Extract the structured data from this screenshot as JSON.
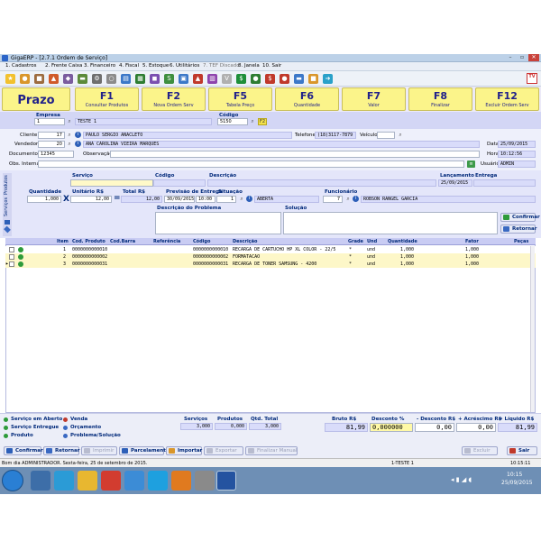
{
  "window": {
    "title": "GigaERP - [2.7.1 Ordem de Serviço]"
  },
  "menu": [
    "1. Cadastros",
    "2. Frente Caixa",
    "3. Financeiro",
    "4. Fiscal",
    "5. Estoque",
    "6. Utilitários",
    "7. TEF Discado",
    "8. Janela",
    "10. Sair"
  ],
  "toolbar": {
    "tv_label": "TV"
  },
  "fkeys": [
    {
      "key": "Prazo",
      "label": ""
    },
    {
      "key": "F1",
      "label": "Consultar Produtos"
    },
    {
      "key": "F2",
      "label": "Nova Ordem Serv"
    },
    {
      "key": "F5",
      "label": "Tabela Preço"
    },
    {
      "key": "F6",
      "label": "Quantidade"
    },
    {
      "key": "F7",
      "label": "Valor"
    },
    {
      "key": "F8",
      "label": "Finalizar"
    },
    {
      "key": "F12",
      "label": "Excluir Ordem Serv"
    }
  ],
  "empresa": {
    "label": "Empresa",
    "code": "1",
    "name": "TESTE 1"
  },
  "codigo": {
    "label": "Código",
    "value": "5150",
    "flag": "F2"
  },
  "cliente": {
    "label": "Cliente",
    "code": "17",
    "name": "PAULO SERGIO ANACLETO"
  },
  "telefone": {
    "label": "Telefone",
    "value": "(18)3117-7879"
  },
  "veiculo": {
    "label": "Veículo",
    "value": ""
  },
  "vendedor": {
    "label": "Vendedor",
    "code": "20",
    "name": "ANA CAROLINA VIEIRA MARQUES"
  },
  "data": {
    "label": "Data",
    "value": "25/09/2015"
  },
  "documento": {
    "label": "Documento",
    "value": "12345"
  },
  "observacao": {
    "label": "Observação",
    "value": ""
  },
  "hora": {
    "label": "Hora",
    "value": "10:12:56"
  },
  "obs_interna": {
    "label": "Obs. Interna",
    "value": ""
  },
  "usuario": {
    "label": "Usuário",
    "value": "ADMIN"
  },
  "side_tabs": [
    "Produtos",
    "Serviços"
  ],
  "servico_form": {
    "servico_label": "Serviço",
    "codigo_label": "Código",
    "descricao_label": "Descrição",
    "lancamento_label": "Lançamento",
    "lancamento_value": "25/09/2015",
    "entrega_label": "Entrega",
    "quantidade_label": "Quantidade",
    "quantidade_value": "1,000",
    "unitario_label": "Unitário R$",
    "unitario_value": "12,00",
    "total_label": "Total R$",
    "total_value": "12,00",
    "previsao_label": "Previsão de Entrega",
    "previsao_date": "30/09/2015",
    "previsao_time": "10:00",
    "situacao_label": "Situação",
    "situacao_code": "1",
    "situacao_value": "ABERTA",
    "funcionario_label": "Funcionário",
    "funcionario_code": "7",
    "funcionario_name": "ROBSON RANGEL GARCIA",
    "problema_label": "Descrição do Problema",
    "solucao_label": "Solução",
    "confirmar": "Confirmar",
    "retornar": "Retornar"
  },
  "grid": {
    "headers": [
      "Item",
      "Cod. Produto",
      "Cod.Barra",
      "Referência",
      "Código",
      "Descrição",
      "Grade",
      "Und",
      "Quantidade",
      "Fator",
      "Peças"
    ],
    "rows": [
      {
        "item": "1",
        "cod": "0000000000010",
        "codigo": "0000000000010",
        "desc": "RECARGA DE CARTUCHO HP XL COLOR - 22/5",
        "grade": "*",
        "und": "und",
        "qtd": "1,000",
        "fator": "1,000"
      },
      {
        "item": "2",
        "cod": "0000000000002",
        "codigo": "0000000000002",
        "desc": "FORMATACAO",
        "grade": "*",
        "und": "und",
        "qtd": "1,000",
        "fator": "1,000"
      },
      {
        "item": "3",
        "cod": "0000000000031",
        "codigo": "0000000000031",
        "desc": "RECARGA DE TONER SAMSUNG - 4200",
        "grade": "*",
        "und": "und",
        "qtd": "1,000",
        "fator": "1,000"
      }
    ]
  },
  "legend": [
    {
      "label": "Serviço em Aberto",
      "color": "#2e9b3a"
    },
    {
      "label": "Venda",
      "color": "#c0392b"
    },
    {
      "label": "Serviço Entregue",
      "color": "#2e9b3a"
    },
    {
      "label": "Orçamento",
      "color": "#3a69c2"
    },
    {
      "label": "Produto",
      "color": "#2e9b3a"
    },
    {
      "label": "Problema/Solução",
      "color": "#3a69c2"
    }
  ],
  "totals": {
    "servicos_label": "Serviços",
    "servicos_value": "3,000",
    "produtos_label": "Produtos",
    "produtos_value": "0,000",
    "qtd_label": "Qtd. Total",
    "qtd_value": "3,000",
    "bruto_label": "Bruto R$",
    "bruto_value": "81,99",
    "desconto_pct_label": "Desconto %",
    "desconto_pct_value": "0,000000",
    "desconto_rs_label": "- Desconto R$",
    "desconto_rs_value": "0,00",
    "acrescimo_label": "+ Acréscimo R$",
    "acrescimo_value": "0,00",
    "liquido_label": "= Líquido R$",
    "liquido_value": "81,99"
  },
  "buttons": {
    "confirmar": "Confirmar",
    "retornar": "Retornar",
    "imprimir": "Imprimir",
    "parcelamento": "Parcelamento",
    "importar": "Importar",
    "exportar": "Exportar",
    "finalizar_manual": "Finalizar Manual",
    "excluir": "Excluir",
    "sair": "Sair"
  },
  "status": {
    "left": "Bom dia ADMINISTRADOR.   Sexta-feira, 25 de setembro de 2015.",
    "mid": "1-TESTE 1",
    "right": "10:15:11"
  },
  "taskbar": {
    "time": "10:15",
    "date": "25/09/2015"
  }
}
